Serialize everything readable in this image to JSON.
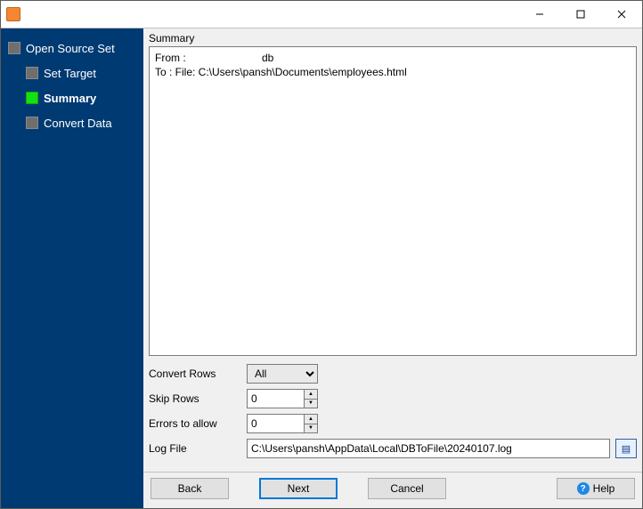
{
  "titlebar": {
    "title": ""
  },
  "sidebar": {
    "items": [
      {
        "label": "Open Source Set"
      },
      {
        "label": "Set Target"
      },
      {
        "label": "Summary"
      },
      {
        "label": "Convert Data"
      }
    ]
  },
  "panel": {
    "heading": "Summary",
    "from_label": "From :",
    "from_value": "db",
    "to_line": "To : File: C:\\Users\\pansh\\Documents\\employees.html"
  },
  "form": {
    "convert_rows": {
      "label": "Convert Rows",
      "value": "All"
    },
    "skip_rows": {
      "label": "Skip Rows",
      "value": "0"
    },
    "errors_allow": {
      "label": "Errors to allow",
      "value": "0"
    },
    "log_file": {
      "label": "Log File",
      "value": "C:\\Users\\pansh\\AppData\\Local\\DBToFile\\20240107.log"
    }
  },
  "buttons": {
    "back": "Back",
    "next": "Next",
    "cancel": "Cancel",
    "help": "Help"
  },
  "icons": {
    "log_browse": "▤",
    "help_q": "?"
  }
}
